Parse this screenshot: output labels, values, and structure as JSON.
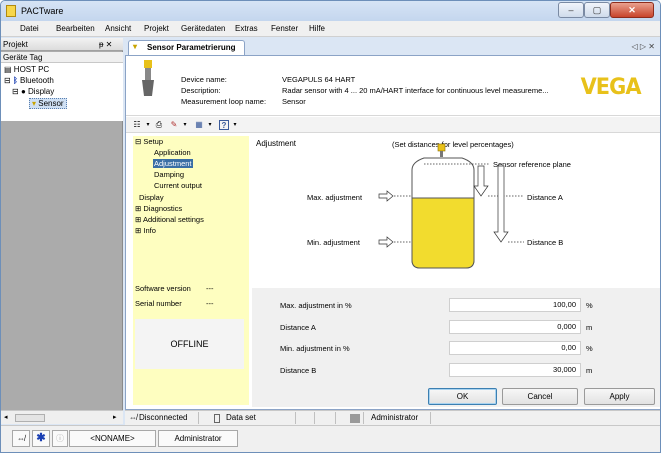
{
  "window": {
    "title": "PACTware",
    "min": "–",
    "max": "▢",
    "close": "✕"
  },
  "menu": [
    "Datei",
    "Bearbeiten",
    "Ansicht",
    "Projekt",
    "Gerätedaten",
    "Extras",
    "Fenster",
    "Hilfe"
  ],
  "project": {
    "header": "Projekt",
    "pin": "ᵽ ✕",
    "subheader": "Geräte Tag",
    "tree": [
      "HOST PC",
      "Bluetooth",
      "Display",
      "Sensor"
    ]
  },
  "tab": {
    "label": "Sensor Parametrierung",
    "nav": "◁ ▷ ✕"
  },
  "device": {
    "name_label": "Device name:",
    "name_value": "VEGAPULS 64 HART",
    "desc_label": "Description:",
    "desc_value": "Radar sensor with 4 ... 20 mA/HART interface for continuous level measureme...",
    "loop_label": "Measurement loop name:",
    "loop_value": "Sensor",
    "logo": "VEGA"
  },
  "nav": {
    "setup": "Setup",
    "application": "Application",
    "adjustment": "Adjustment",
    "damping": "Damping",
    "current_output": "Current output",
    "display": "Display",
    "diagnostics": "Diagnostics",
    "additional": "Additional settings",
    "info": "Info",
    "software_label": "Software version",
    "software_value": "---",
    "serial_label": "Serial number",
    "serial_value": "---",
    "offline": "OFFLINE"
  },
  "diagram": {
    "title": "Adjustment",
    "subtitle": "(Set distances for level percentages)",
    "ref_plane": "Sensor reference plane",
    "max_label": "Max. adjustment",
    "min_label": "Min. adjustment",
    "dist_a": "Distance A",
    "dist_b": "Distance B"
  },
  "params": [
    {
      "label": "Max. adjustment in %",
      "value": "100,00",
      "unit": "%"
    },
    {
      "label": "Distance A",
      "value": "0,000",
      "unit": "m"
    },
    {
      "label": "Min. adjustment in %",
      "value": "0,00",
      "unit": "%"
    },
    {
      "label": "Distance B",
      "value": "30,000",
      "unit": "m"
    }
  ],
  "buttons": {
    "ok": "OK",
    "cancel": "Cancel",
    "apply": "Apply"
  },
  "status": {
    "connection": "Disconnected",
    "dataset": "Data set",
    "user": "Administrator"
  },
  "bottom": {
    "noname": "<NONAME>",
    "user": "Administrator"
  },
  "colors": {
    "accent": "#e8c11a",
    "nav_bg": "#fefec0",
    "selection": "#3a6ea5",
    "liquid": "#f2dc2e"
  }
}
